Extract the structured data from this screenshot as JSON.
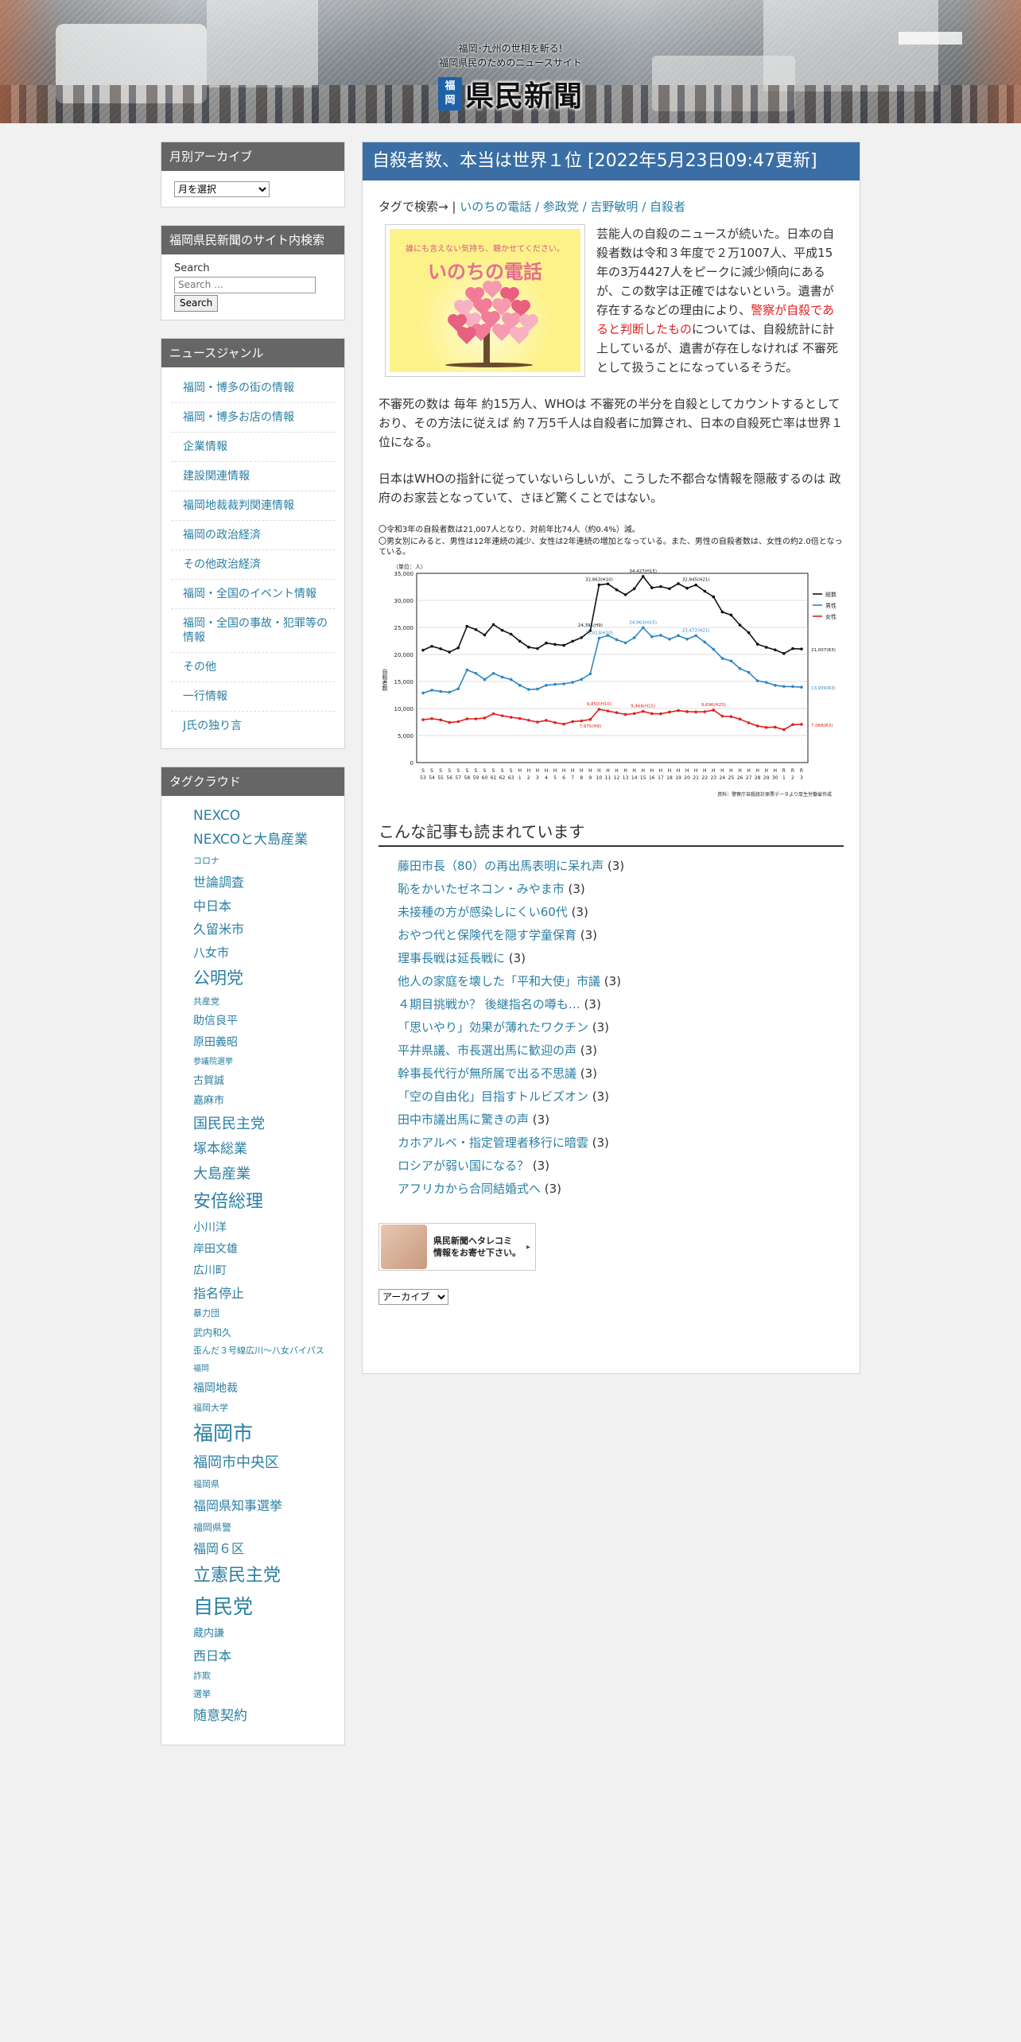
{
  "header": {
    "tagline1": "福岡･九州の世相を斬る!",
    "tagline2": "福岡県民のためのニュースサイト",
    "badge_top": "福",
    "badge_bottom": "岡",
    "site_name": "県民新聞"
  },
  "sidebar": {
    "archive": {
      "title": "月別アーカイブ",
      "select_value": "月を選択"
    },
    "search": {
      "title": "福岡県民新聞のサイト内検索",
      "label": "Search",
      "placeholder": "Search …",
      "button": "Search"
    },
    "genre": {
      "title": "ニュースジャンル",
      "items": [
        "福岡・博多の街の情報",
        "福岡・博多お店の情報",
        "企業情報",
        "建設関連情報",
        "福岡地裁裁判関連情報",
        "福岡の政治経済",
        "その他政治経済",
        "福岡・全国のイベント情報",
        "福岡・全国の事故・犯罪等の情報",
        "その他",
        "一行情報",
        "J氏の独り言"
      ]
    },
    "tagcloud": {
      "title": "タグクラウド",
      "items": [
        {
          "label": "NEXCO",
          "size": 17
        },
        {
          "label": "NEXCOと大島産業",
          "size": 17
        },
        {
          "label": "コロナ",
          "size": 11
        },
        {
          "label": "世論調査",
          "size": 16
        },
        {
          "label": "中日本",
          "size": 16
        },
        {
          "label": "久留米市",
          "size": 16
        },
        {
          "label": "八女市",
          "size": 15
        },
        {
          "label": "公明党",
          "size": 21
        },
        {
          "label": "共産党",
          "size": 11
        },
        {
          "label": "助信良平",
          "size": 14
        },
        {
          "label": "原田義昭",
          "size": 14
        },
        {
          "label": "参議院選挙",
          "size": 10
        },
        {
          "label": "古賀誠",
          "size": 13
        },
        {
          "label": "嘉麻市",
          "size": 13
        },
        {
          "label": "国民民主党",
          "size": 18
        },
        {
          "label": "塚本総業",
          "size": 17
        },
        {
          "label": "大島産業",
          "size": 18
        },
        {
          "label": "安倍総理",
          "size": 22
        },
        {
          "label": "小川洋",
          "size": 14
        },
        {
          "label": "岸田文雄",
          "size": 14
        },
        {
          "label": "広川町",
          "size": 14
        },
        {
          "label": "指名停止",
          "size": 16
        },
        {
          "label": "暴力団",
          "size": 11
        },
        {
          "label": "武内和久",
          "size": 12
        },
        {
          "label": "歪んだ３号線広川～八女バイパス",
          "size": 11
        },
        {
          "label": "福岡",
          "size": 10
        },
        {
          "label": "福岡地裁",
          "size": 14
        },
        {
          "label": "福岡大学",
          "size": 11
        },
        {
          "label": "福岡市",
          "size": 25
        },
        {
          "label": "福岡市中央区",
          "size": 18
        },
        {
          "label": "福岡県",
          "size": 11
        },
        {
          "label": "福岡県知事選挙",
          "size": 16
        },
        {
          "label": "福岡県警",
          "size": 12
        },
        {
          "label": "福岡６区",
          "size": 16
        },
        {
          "label": "立憲民主党",
          "size": 22
        },
        {
          "label": "自民党",
          "size": 25
        },
        {
          "label": "蔵内謙",
          "size": 13
        },
        {
          "label": "西日本",
          "size": 16
        },
        {
          "label": "詐欺",
          "size": 11
        },
        {
          "label": "選挙",
          "size": 11
        },
        {
          "label": "随意契約",
          "size": 17
        }
      ]
    }
  },
  "post": {
    "title": "自殺者数、本当は世界１位 [2022年5月23日09:47更新]",
    "tag_prefix": "タグで検索→ |",
    "tags": [
      "いのちの電話",
      "参政党",
      "吉野敏明",
      "自殺者"
    ],
    "thumb_caption": "誰にも言えない気持ち、聴かせてください。",
    "thumb_title": "いのちの電話",
    "intro_1": "芸能人の自殺のニュースが続いた。日本の自殺者数は令和３年度で２万1007人、平成15年の3万4427人をピークに減少傾向にあるが、この数字は正確ではないという。遺書が存在するなどの理由により、",
    "intro_red": "警察が自殺であると判断したもの",
    "intro_2": "については、自殺統計に計上しているが、遺書が存在しなければ 不審死として扱うことになっているそうだ。",
    "para_2": "不審死の数は 毎年 約15万人、WHOは 不審死の半分を自殺としてカウントするとしており、その方法に従えば 約７万5千人は自殺者に加算され、日本の自殺死亡率は世界１位になる。",
    "para_3": "日本はWHOの指針に従っていないらしいが、こうした不都合な情報を隠蔽するのは 政府のお家芸となっていて、さほど驚くことではない。"
  },
  "chart_data": {
    "type": "line",
    "note1": "〇令和3年の自殺者数は21,007人となり、対前年比74人（約0.4%）減。",
    "note2": "〇男女別にみると、男性は12年連続の減少、女性は2年連続の増加となっている。また、男性の自殺者数は、女性の約2.0倍となっている。",
    "unit_label": "（単位：人）",
    "ylabel": "自殺者数",
    "ylim": [
      0,
      35000
    ],
    "yticks": [
      "0",
      "5,000",
      "10,000",
      "15,000",
      "20,000",
      "25,000",
      "30,000",
      "35,000"
    ],
    "x_labels": [
      "S53",
      "S54",
      "S55",
      "S56",
      "S57",
      "S58",
      "S59",
      "S60",
      "S61",
      "S62",
      "S63",
      "H1",
      "H2",
      "H3",
      "H4",
      "H5",
      "H6",
      "H7",
      "H8",
      "H9",
      "H10",
      "H11",
      "H12",
      "H13",
      "H14",
      "H15",
      "H16",
      "H17",
      "H18",
      "H19",
      "H20",
      "H21",
      "H22",
      "H23",
      "H24",
      "H25",
      "H26",
      "H27",
      "H28",
      "H29",
      "H30",
      "R1",
      "R2",
      "R3"
    ],
    "series": [
      {
        "name": "総数",
        "color": "#111111",
        "values": [
          20788,
          21503,
          21048,
          20434,
          21228,
          25202,
          24596,
          23599,
          25524,
          24460,
          23742,
          22436,
          21346,
          21084,
          22104,
          21851,
          21679,
          22445,
          23104,
          24391,
          32863,
          33048,
          31957,
          31042,
          32143,
          34427,
          32325,
          32552,
          32155,
          33093,
          32249,
          32845,
          31690,
          30651,
          27858,
          27283,
          25427,
          24025,
          21897,
          21321,
          20840,
          20169,
          21081,
          21007
        ]
      },
      {
        "name": "男性",
        "color": "#2f86c4",
        "values": [
          12859,
          13386,
          13155,
          13011,
          13654,
          17116,
          16508,
          15356,
          16499,
          15802,
          15359,
          14289,
          13515,
          13592,
          14296,
          14468,
          14560,
          14853,
          15393,
          16416,
          23013,
          23512,
          22727,
          22144,
          23080,
          24963,
          23272,
          23540,
          22813,
          23478,
          22831,
          23472,
          22283,
          20955,
          19273,
          18787,
          17386,
          16681,
          15121,
          14826,
          14290,
          14078,
          14055,
          13939
        ]
      },
      {
        "name": "女性",
        "color": "#e0201d",
        "values": [
          7929,
          8117,
          7893,
          7423,
          7574,
          8086,
          8088,
          8243,
          9025,
          8658,
          8383,
          8147,
          7831,
          7492,
          7808,
          7383,
          7119,
          7592,
          7711,
          7975,
          9850,
          9536,
          9230,
          8898,
          9063,
          9464,
          9053,
          9012,
          9342,
          9615,
          9418,
          9373,
          9407,
          9696,
          8585,
          8496,
          8041,
          7344,
          6776,
          6495,
          6550,
          6091,
          7026,
          7068
        ]
      }
    ],
    "annotations": [
      "32,863(H10)",
      "34,427(H15)",
      "32,845(H21)",
      "24,391(H9)",
      "23,013(H10)",
      "24,963(H15)",
      "23,472(H21)",
      "9,850(H10)",
      "9,464(H15)",
      "9,696(H23)",
      "7,975(H9)",
      "21,007(R3)",
      "13,939(R3)",
      "7,068(R3)"
    ],
    "source": "資料：警察庁自殺統計原票データより厚生労働省作成"
  },
  "related": {
    "title": "こんな記事も読まれています",
    "items": [
      {
        "text": "藤田市長（80）の再出馬表明に呆れ声",
        "count": "(3)"
      },
      {
        "text": "恥をかいたゼネコン・みやま市",
        "count": "(3)"
      },
      {
        "text": "未接種の方が感染しにくい60代",
        "count": "(3)"
      },
      {
        "text": "おやつ代と保険代を隠す学童保育",
        "count": "(3)"
      },
      {
        "text": "理事長戦は延長戦に",
        "count": "(3)"
      },
      {
        "text": "他人の家庭を壊した「平和大使」市議",
        "count": "(3)"
      },
      {
        "text": "４期目挑戦か？ 後継指名の噂も…",
        "count": "(3)"
      },
      {
        "text": "「思いやり」効果が薄れたワクチン",
        "count": "(3)"
      },
      {
        "text": "平井県議、市長選出馬に歓迎の声",
        "count": "(3)"
      },
      {
        "text": "幹事長代行が無所属で出る不思議",
        "count": "(3)"
      },
      {
        "text": "「空の自由化」目指すトルビズオン",
        "count": "(3)"
      },
      {
        "text": "田中市議出馬に驚きの声",
        "count": "(3)"
      },
      {
        "text": "カホアルベ・指定管理者移行に暗雲",
        "count": "(3)"
      },
      {
        "text": "ロシアが弱い国になる？",
        "count": "(3)"
      },
      {
        "text": "アフリカから合同結婚式へ",
        "count": "(3)"
      }
    ]
  },
  "banner": {
    "line1": "県民新聞へタレコミ",
    "line2": "情報をお寄せ下さい。"
  },
  "archive_select": "アーカイブ"
}
